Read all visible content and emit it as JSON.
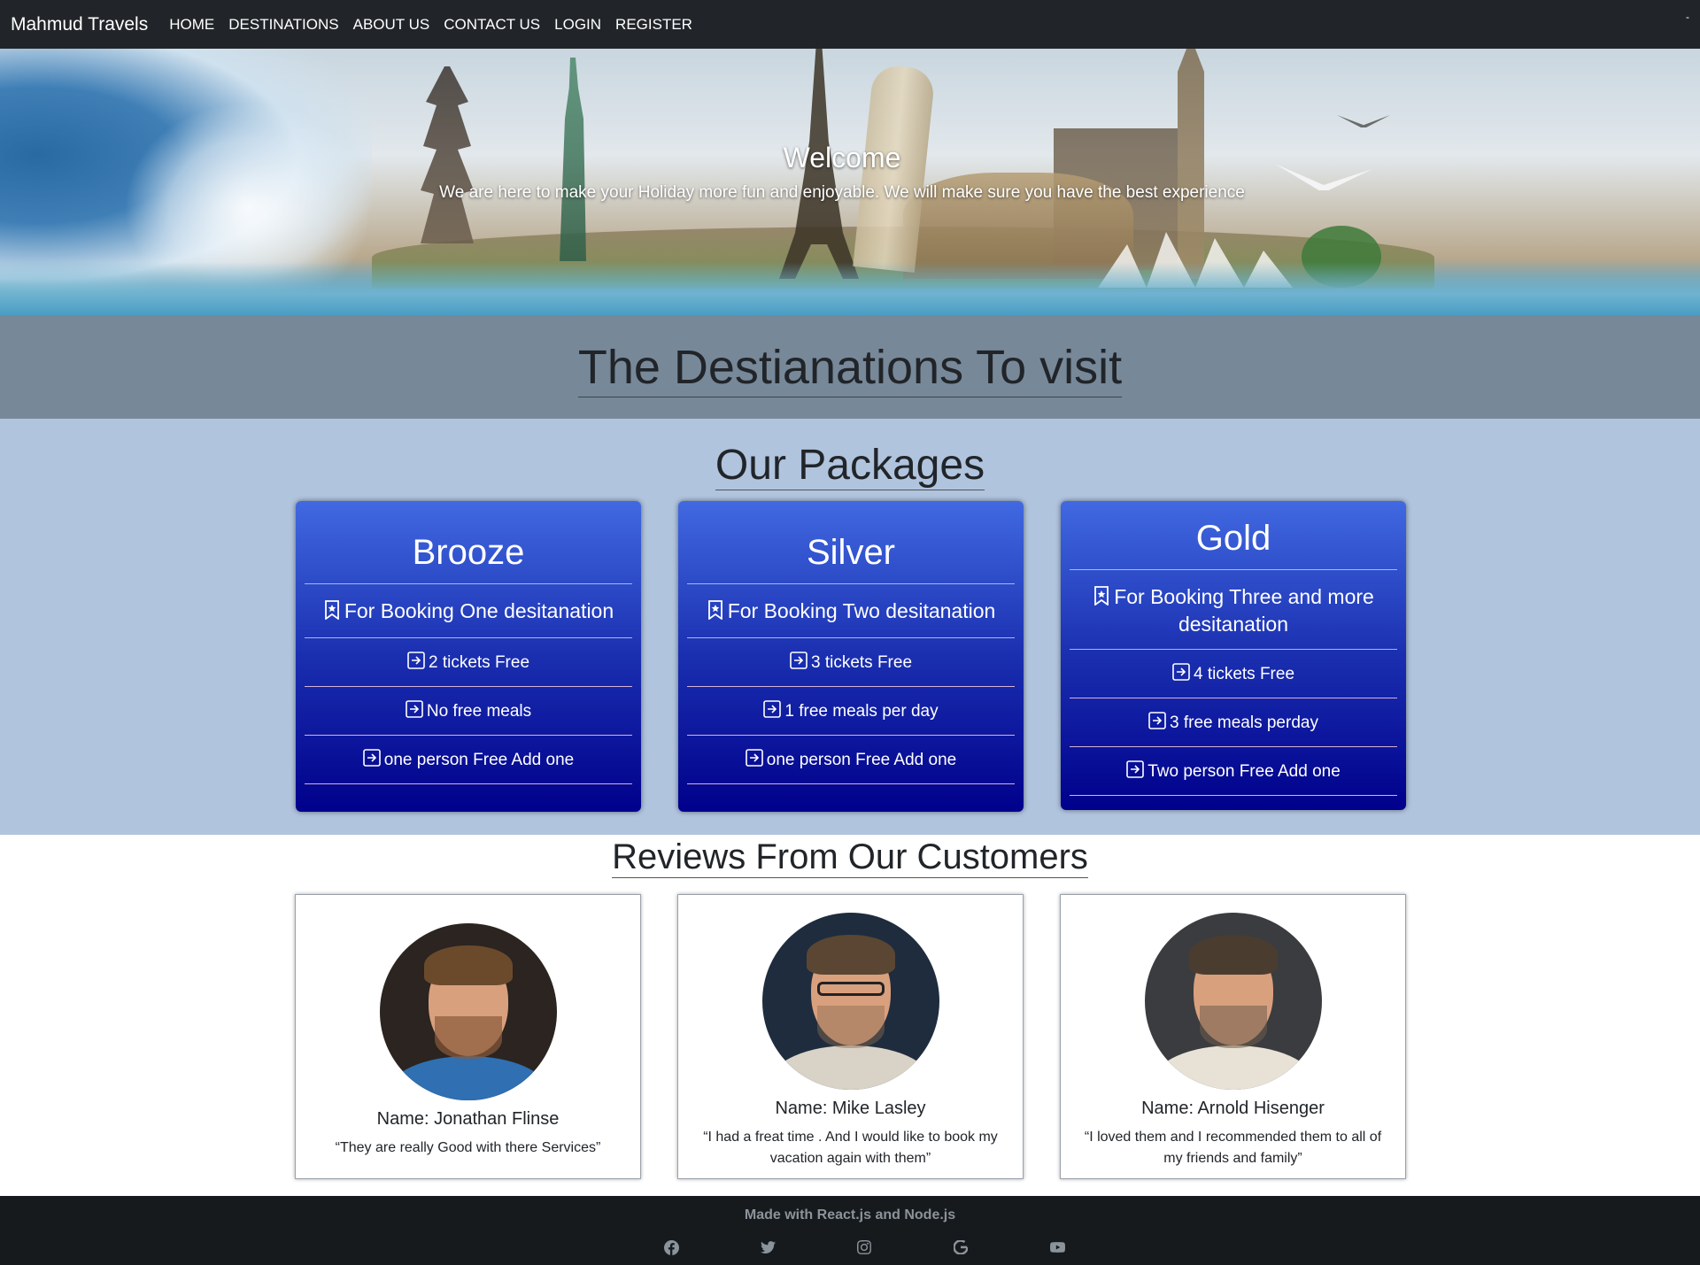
{
  "navbar": {
    "brand": "Mahmud Travels",
    "items": [
      {
        "label": "HOME"
      },
      {
        "label": "DESTINATIONS"
      },
      {
        "label": "ABOUT US"
      },
      {
        "label": "CONTACT US"
      },
      {
        "label": "LOGIN"
      },
      {
        "label": "REGISTER"
      }
    ],
    "corner": "-"
  },
  "hero": {
    "title": "Welcome",
    "subtitle": "We are here to make your Holiday more fun and enjoyable. We will make sure you have the best experience"
  },
  "destinations": {
    "title": "The Destianations To visit"
  },
  "packages": {
    "title": "Our Packages",
    "cards": [
      {
        "name": "Brooze",
        "booking": "For Booking One desitanation",
        "features": [
          "2 tickets Free",
          "No free meals",
          "one person Free Add one"
        ]
      },
      {
        "name": "Silver",
        "booking": "For Booking Two desitanation",
        "features": [
          "3 tickets Free",
          "1 free meals per day",
          "one person Free Add one"
        ]
      },
      {
        "name": "Gold",
        "booking": "For Booking Three and more desitanation",
        "features": [
          "4 tickets Free",
          "3 free meals perday",
          "Two person Free Add one"
        ]
      }
    ]
  },
  "reviews": {
    "title": "Reviews From Our Customers",
    "items": [
      {
        "name": "Name: Jonathan Flinse",
        "quote": "“They are really Good with there Services”"
      },
      {
        "name": "Name: Mike Lasley",
        "quote": "“I had a freat time . And I would like to book my vacation again with them”"
      },
      {
        "name": "Name: Arnold Hisenger",
        "quote": "“I loved them and I recommended them to all of my friends and family”"
      }
    ]
  },
  "footer": {
    "text": "Made with React.js and Node.js",
    "social": [
      "facebook-icon",
      "twitter-icon",
      "instagram-icon",
      "google-icon",
      "youtube-icon"
    ]
  },
  "colors": {
    "navbar_bg": "#212529",
    "dest_bg": "#778899",
    "packages_bg": "#b0c4de",
    "card_top": "#4169e1",
    "card_bottom": "#00008b",
    "footer_bg": "#171a1c"
  }
}
